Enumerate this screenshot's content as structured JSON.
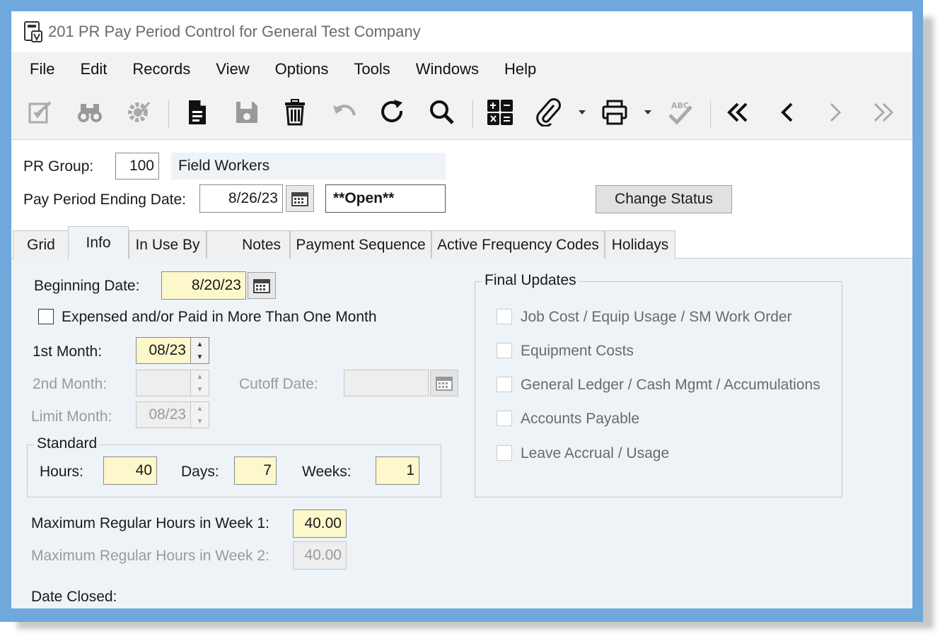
{
  "window": {
    "title": "201 PR Pay Period Control for General Test Company"
  },
  "menu": [
    "File",
    "Edit",
    "Records",
    "View",
    "Options",
    "Tools",
    "Windows",
    "Help"
  ],
  "toolbar": {
    "icons": [
      "edit-note-icon",
      "binoculars-icon",
      "settings-gear-icon",
      "new-document-icon",
      "save-icon",
      "delete-trash-icon",
      "undo-icon",
      "refresh-icon",
      "search-icon",
      "calculator-icon",
      "attachment-icon",
      "print-icon",
      "spell-check-icon",
      "first-record-icon",
      "previous-record-icon",
      "next-record-icon",
      "last-record-icon"
    ]
  },
  "header": {
    "pr_group_label": "PR Group:",
    "pr_group_value": "100",
    "pr_group_desc": "Field Workers",
    "ending_date_label": "Pay Period Ending Date:",
    "ending_date_value": "8/26/23",
    "status_value": "**Open**",
    "change_status_label": "Change Status"
  },
  "tabs": [
    "Grid",
    "Info",
    "In Use By",
    "Notes",
    "Payment Sequence",
    "Active Frequency Codes",
    "Holidays"
  ],
  "active_tab": "Info",
  "info": {
    "beginning_date_label": "Beginning Date:",
    "beginning_date_value": "8/20/23",
    "expensed_label": "Expensed and/or Paid in More Than One Month",
    "expensed_checked": false,
    "first_month_label": "1st Month:",
    "first_month_value": "08/23",
    "second_month_label": "2nd Month:",
    "second_month_value": "",
    "cutoff_date_label": "Cutoff Date:",
    "cutoff_date_value": "",
    "limit_month_label": "Limit Month:",
    "limit_month_value": "08/23",
    "standard_title": "Standard",
    "hours_label": "Hours:",
    "hours_value": "40",
    "days_label": "Days:",
    "days_value": "7",
    "weeks_label": "Weeks:",
    "weeks_value": "1",
    "max_week1_label": "Maximum Regular Hours in Week 1:",
    "max_week1_value": "40.00",
    "max_week2_label": "Maximum Regular Hours in Week 2:",
    "max_week2_value": "40.00",
    "date_closed_label": "Date Closed:"
  },
  "final_updates": {
    "title": "Final Updates",
    "items": [
      {
        "label": "Job Cost / Equip Usage / SM Work Order",
        "checked": false
      },
      {
        "label": "Equipment Costs",
        "checked": false
      },
      {
        "label": "General Ledger / Cash Mgmt / Accumulations",
        "checked": false
      },
      {
        "label": "Accounts Payable",
        "checked": false
      },
      {
        "label": "Leave Accrual / Usage",
        "checked": false
      }
    ]
  },
  "colors": {
    "frame": "#6ea8dc",
    "required_field": "#fdf7cc",
    "panel": "#eef3f8"
  }
}
